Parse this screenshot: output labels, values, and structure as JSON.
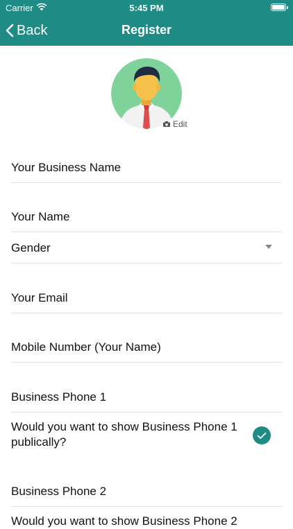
{
  "status_bar": {
    "carrier": "Carrier",
    "time": "5:45 PM"
  },
  "nav": {
    "back_label": "Back",
    "title": "Register"
  },
  "profile": {
    "edit_label": "Edit"
  },
  "form": {
    "business_name": "Your Business Name",
    "your_name": "Your Name",
    "gender": "Gender",
    "email": "Your Email",
    "mobile": "Mobile Number (Your Name)",
    "business_phone_1": "Business Phone 1",
    "show_phone_1": "Would you want to show Business Phone 1 publically?",
    "show_phone_1_checked": true,
    "business_phone_2": "Business Phone 2",
    "show_phone_2_partial": "Would you want to show Business Phone 2"
  },
  "colors": {
    "accent": "#1e8c85",
    "avatar_bg": "#7fd39a"
  },
  "icons": [
    "wifi-icon",
    "battery-icon",
    "back-chevron-icon",
    "camera-icon",
    "dropdown-caret-icon",
    "checkmark-icon"
  ]
}
